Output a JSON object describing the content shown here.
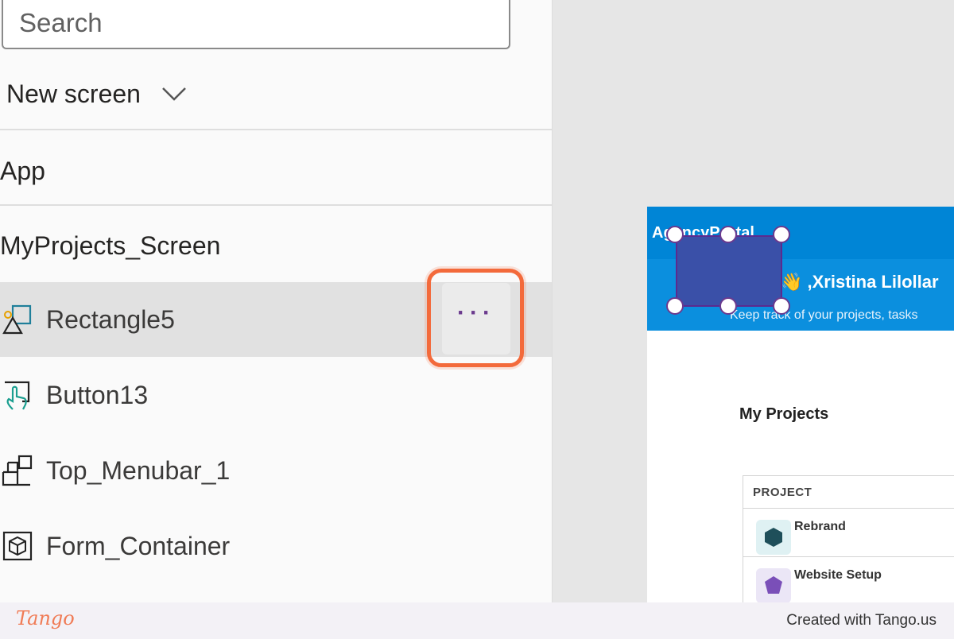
{
  "search": {
    "placeholder": "Search"
  },
  "new_screen": {
    "label": "New screen"
  },
  "tree": {
    "app_label": "App",
    "screen_label": "MyProjects_Screen",
    "items": [
      {
        "label": "Rectangle5",
        "icon": "rectangle-icon",
        "selected": true
      },
      {
        "label": "Button13",
        "icon": "button-icon",
        "selected": false
      },
      {
        "label": "Top_Menubar_1",
        "icon": "container-icon",
        "selected": false
      },
      {
        "label": "Form_Container",
        "icon": "form-container-icon",
        "selected": false
      }
    ],
    "more_button_label": "···"
  },
  "canvas": {
    "portal_title": "AgencyPortal",
    "greeting": "👋 ,Xristina Lilollar",
    "subtitle": "Keep track of your projects, tasks",
    "section_title": "My Projects",
    "table_header": "PROJECT",
    "projects": [
      "Rebrand",
      "Website Setup"
    ]
  },
  "footer": {
    "logo": "Tango",
    "created_with": "Created with Tango.us"
  },
  "colors": {
    "accent_highlight": "#f36a3b",
    "header_blue": "#0085d6",
    "selected_rect": "#3a50a8",
    "handle_border": "#6b3a8e"
  }
}
